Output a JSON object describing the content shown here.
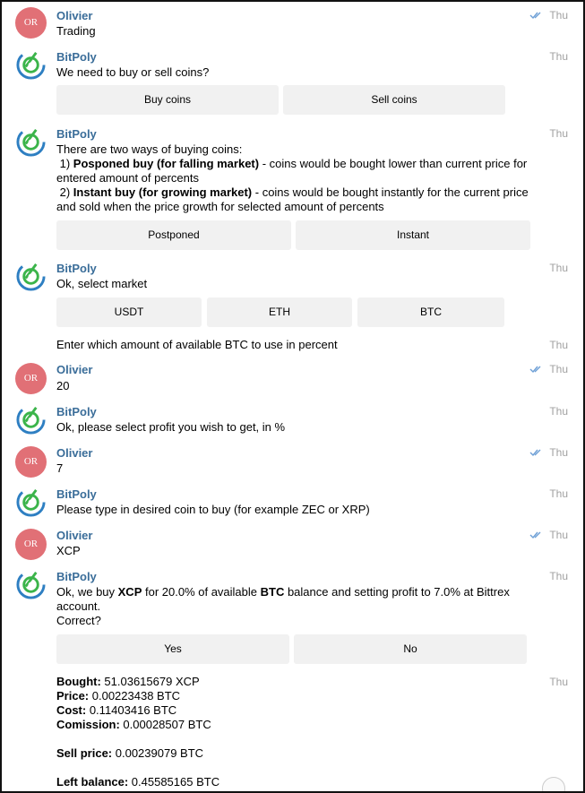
{
  "messages": [
    {
      "sender": "Olivier",
      "initials": "OR",
      "time": "Thu",
      "text": "Trading"
    },
    {
      "sender": "BitPoly",
      "time": "Thu",
      "text": "We need to buy or sell coins?",
      "buttons": [
        "Buy coins",
        "Sell coins"
      ]
    },
    {
      "sender": "BitPoly",
      "time": "Thu",
      "line1": "There are two ways of buying coins:",
      "opt1_prefix": " 1) ",
      "opt1_bold": "Posponed buy (for falling market)",
      "opt1_rest": " - coins would be bought lower than current price for entered amount of percents",
      "opt2_prefix": " 2) ",
      "opt2_bold": "Instant buy (for growing market)",
      "opt2_rest": " - coins would be bought instantly for the current price and sold when the price growth for selected amount of percents",
      "buttons": [
        "Postponed",
        "Instant"
      ]
    },
    {
      "sender": "BitPoly",
      "time": "Thu",
      "text": "Ok, select market",
      "buttons": [
        "USDT",
        "ETH",
        "BTC"
      ]
    },
    {
      "time": "Thu",
      "text": "Enter which amount of available BTC to use in percent"
    },
    {
      "sender": "Olivier",
      "initials": "OR",
      "time": "Thu",
      "text": "20"
    },
    {
      "sender": "BitPoly",
      "time": "Thu",
      "text": "Ok, please select profit you wish to get, in %"
    },
    {
      "sender": "Olivier",
      "initials": "OR",
      "time": "Thu",
      "text": "7"
    },
    {
      "sender": "BitPoly",
      "time": "Thu",
      "text": "Please type in desired coin to buy (for example ZEC or XRP)"
    },
    {
      "sender": "Olivier",
      "initials": "OR",
      "time": "Thu",
      "text": "XCP"
    },
    {
      "sender": "BitPoly",
      "time": "Thu",
      "p1": "Ok, we buy ",
      "b1": "XCP",
      "p2": " for 20.0% of available ",
      "b2": "BTC",
      "p3": " balance and setting profit to 7.0% at Bittrex account.",
      "line2": "Correct?",
      "buttons": [
        "Yes",
        "No"
      ]
    },
    {
      "time": "Thu",
      "rows": [
        {
          "label": "Bought:",
          "value": " 51.03615679 XCP"
        },
        {
          "label": "Price:",
          "value": " 0.00223438 BTC"
        },
        {
          "label": "Cost:",
          "value": " 0.11403416 BTC"
        },
        {
          "label": "Comission:",
          "value": " 0.00028507 BTC"
        },
        {
          "label": "Sell price:",
          "value": " 0.00239079 BTC"
        },
        {
          "label": "Left balance:",
          "value": " 0.45585165 BTC"
        }
      ]
    }
  ],
  "colors": {
    "sender_name": "#3a6d99",
    "avatar_or": "#e17076",
    "check": "#6d9fd6",
    "logo_green": "#3bb44a",
    "logo_blue": "#2e7fc2",
    "button_bg": "#f1f1f1"
  },
  "icons": {
    "read_receipt": "double-check-icon",
    "bot_avatar": "bitpoly-logo-icon"
  }
}
